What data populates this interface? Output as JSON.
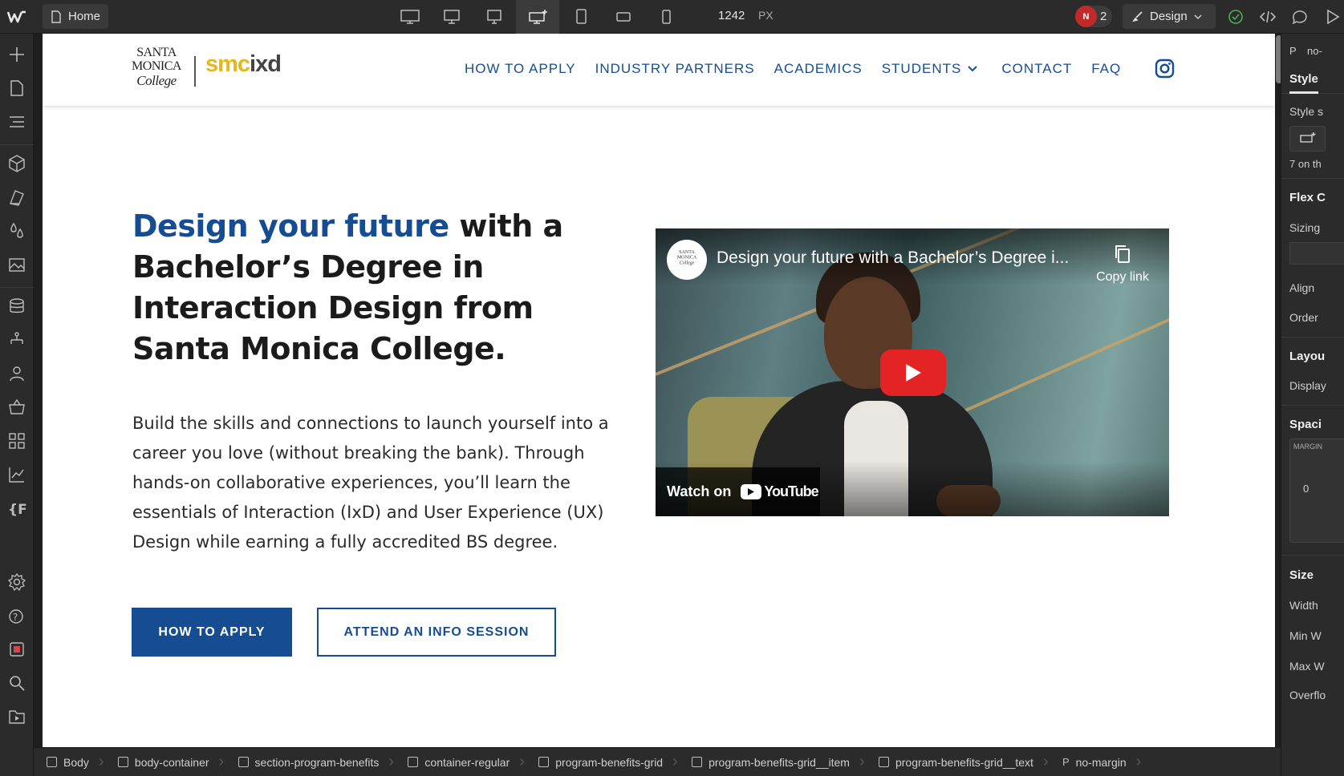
{
  "topbar": {
    "page_name": "Home",
    "viewport_width": "1242",
    "viewport_unit": "PX",
    "collaborator_initial": "N",
    "collaborator_count": "2",
    "mode_label": "Design"
  },
  "site": {
    "logo_college": "SANTA\nMONICA\nCOLLEGE",
    "logo_prefix": "smc",
    "logo_suffix": "ixd",
    "nav": [
      "HOW TO APPLY",
      "INDUSTRY PARTNERS",
      "ACADEMICS",
      "STUDENTS",
      "CONTACT",
      "FAQ"
    ],
    "hero_title_highlight": "Design your future",
    "hero_title_rest": " with a Bachelor’s Degree in Interaction Design from Santa Monica College.",
    "hero_body": "Build the skills and connections to launch yourself into a career you love (without breaking the bank). Through hands-on collaborative experiences, you’ll learn the essentials of Interaction (IxD) and User Experience (UX) Design while earning a fully accredited BS degree.",
    "btn_primary": "HOW TO APPLY",
    "btn_secondary": "ATTEND AN INFO SESSION"
  },
  "video": {
    "channel_logo": "SANTA MONICA COLLEGE",
    "title": "Design your future with a Bachelor’s Degree i...",
    "copy_link": "Copy link",
    "watch_on": "Watch on",
    "youtube": "YouTube"
  },
  "right_panel": {
    "element_tag": "P",
    "element_name": "no-",
    "tab": "Style",
    "style_selector": "Style s",
    "on_this": "7 on th",
    "flex_child": "Flex C",
    "sizing": "Sizing",
    "align": "Align",
    "order": "Order",
    "layout": "Layou",
    "display": "Display",
    "spacing": "Spaci",
    "margin": "MARGIN",
    "margin_value": "0",
    "size": "Size",
    "width": "Width",
    "min_w": "Min W",
    "max_w": "Max W",
    "overflow": "Overflo"
  },
  "breadcrumbs": [
    {
      "label": "Body",
      "kind": "box"
    },
    {
      "label": "body-container",
      "kind": "box"
    },
    {
      "label": "section-program-benefits",
      "kind": "box"
    },
    {
      "label": "container-regular",
      "kind": "box"
    },
    {
      "label": "program-benefits-grid",
      "kind": "box"
    },
    {
      "label": "program-benefits-grid__item",
      "kind": "box"
    },
    {
      "label": "program-benefits-grid__text",
      "kind": "box"
    },
    {
      "label": "no-margin",
      "kind": "p"
    }
  ],
  "icons": {
    "breakpoints": [
      "desktop-xl-icon",
      "desktop-large-icon",
      "desktop-icon",
      "desktop-base-icon",
      "tablet-icon",
      "mobile-landscape-icon",
      "mobile-portrait-icon"
    ],
    "left_rail": [
      "add-icon",
      "pages-icon",
      "navigator-icon",
      "components-icon",
      "styles-icon",
      "variables-icon",
      "assets-icon",
      "cms-icon",
      "logic-icon",
      "users-icon",
      "ecommerce-icon",
      "apps-icon",
      "analytics-icon",
      "code-icon",
      "settings-icon",
      "help-icon",
      "record-icon",
      "search-icon",
      "video-tutorials-icon"
    ]
  },
  "colors": {
    "brand_blue": "#164d92",
    "logo_yellow": "#e4b71f",
    "youtube_red": "#e42424",
    "collab_red": "#c22a2a"
  }
}
